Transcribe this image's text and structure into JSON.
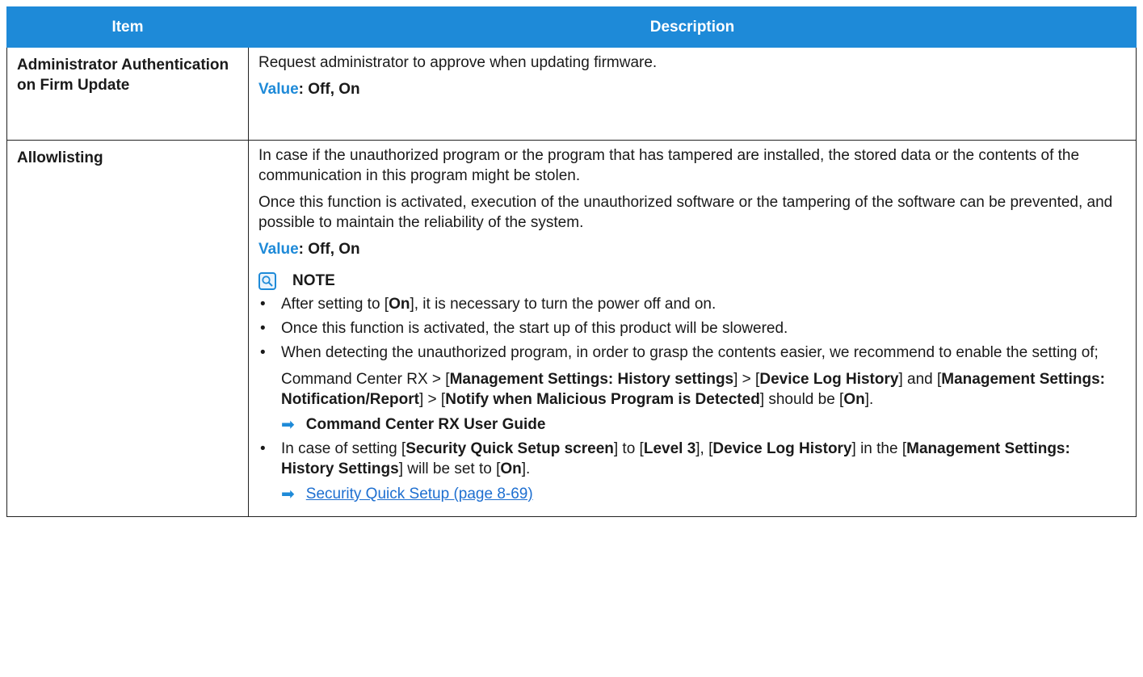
{
  "table": {
    "headers": {
      "item": "Item",
      "description": "Description"
    },
    "row1": {
      "item": "Administrator Authentication on Firm Update",
      "description": "Request administrator to approve when updating firmware.",
      "value_label": "Value",
      "value_text": ": Off, On"
    },
    "row2": {
      "item": "Allowlisting",
      "para1": "In case if the unauthorized program or the program that has tampered are installed, the stored data or the contents of the communication in this program might be stolen.",
      "para2": "Once this function is activated, execution of the unauthorized software or the tampering of the software can be prevented, and possible to maintain the reliability of the system.",
      "value_label": "Value",
      "value_text": ": Off, On",
      "note_title": "NOTE",
      "note1": {
        "pre": "After setting to [",
        "bold": "On",
        "post": "], it is necessary to turn the power off and on."
      },
      "note2": "Once this function is activated, the start up of this product will be slowered.",
      "note3": {
        "intro": "When detecting the unauthorized program, in order to grasp the contents easier, we recommend to enable the setting of;",
        "t1": "Command Center RX > [",
        "b1": "Management Settings: History settings",
        "t2": "] > [",
        "b2": "Device Log History",
        "t3": "] and [",
        "b3": "Management Settings: Notification/Report",
        "t4": "] > [",
        "b4": "Notify when Malicious Program is Detected",
        "t5": "] should be [",
        "b5": "On",
        "t6": "].",
        "ref": "Command Center RX User Guide"
      },
      "note4": {
        "t1": "In case of setting [",
        "b1": "Security Quick Setup screen",
        "t2": "] to [",
        "b2": "Level 3",
        "t3": "], [",
        "b3": "Device Log History",
        "t4": "] in the [",
        "b4": "Management Settings: History Settings",
        "t5": "] will be set to [",
        "b5": "On",
        "t6": "].",
        "link": "Security Quick Setup (page 8-69)"
      }
    }
  },
  "icons": {
    "note": "note-magnifier-icon",
    "arrow": "right-arrow-icon"
  },
  "colors": {
    "header_bg": "#1e8ad8",
    "accent": "#1e8ad8",
    "link": "#1e6fd0"
  }
}
